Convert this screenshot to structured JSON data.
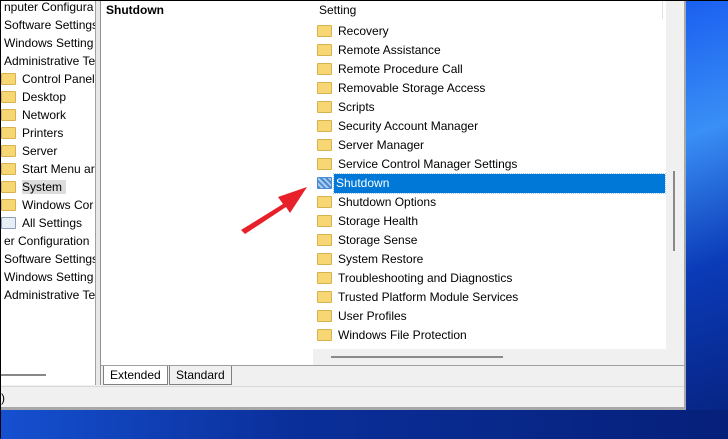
{
  "tree": {
    "items": [
      {
        "label": "nputer Configura",
        "indent": 0,
        "icon": "none"
      },
      {
        "label": "Software Settings",
        "indent": 0,
        "icon": "none"
      },
      {
        "label": "Windows Setting",
        "indent": 0,
        "icon": "none"
      },
      {
        "label": "Administrative Te",
        "indent": 0,
        "icon": "none"
      },
      {
        "label": "Control Panel",
        "indent": 1,
        "icon": "folder-icon"
      },
      {
        "label": "Desktop",
        "indent": 1,
        "icon": "folder-icon"
      },
      {
        "label": "Network",
        "indent": 1,
        "icon": "folder-icon"
      },
      {
        "label": "Printers",
        "indent": 1,
        "icon": "folder-icon"
      },
      {
        "label": "Server",
        "indent": 1,
        "icon": "folder-icon"
      },
      {
        "label": "Start Menu ar",
        "indent": 1,
        "icon": "folder-icon"
      },
      {
        "label": "System",
        "indent": 1,
        "icon": "folder-icon",
        "selected": true
      },
      {
        "label": "Windows Cor",
        "indent": 1,
        "icon": "folder-icon"
      },
      {
        "label": "All Settings",
        "indent": 1,
        "icon": "settings-list-icon"
      },
      {
        "label": "er Configuration",
        "indent": 0,
        "icon": "none"
      },
      {
        "label": "Software Settings",
        "indent": 0,
        "icon": "none"
      },
      {
        "label": "Windows Setting",
        "indent": 0,
        "icon": "none"
      },
      {
        "label": "Administrative Te",
        "indent": 0,
        "icon": "none"
      }
    ]
  },
  "description": {
    "title": "Shutdown"
  },
  "list": {
    "header": "Setting",
    "items": [
      "Recovery",
      "Remote Assistance",
      "Remote Procedure Call",
      "Removable Storage Access",
      "Scripts",
      "Security Account Manager",
      "Server Manager",
      "Service Control Manager Settings",
      "Shutdown",
      "Shutdown Options",
      "Storage Health",
      "Storage Sense",
      "System Restore",
      "Troubleshooting and Diagnostics",
      "Trusted Platform Module Services",
      "User Profiles",
      "Windows File Protection"
    ],
    "selected_index": 8
  },
  "tabs": [
    "Extended",
    "Standard"
  ],
  "status": {
    "text": ")"
  },
  "colors": {
    "selection": "#0078d7",
    "arrow": "#e8202a"
  }
}
